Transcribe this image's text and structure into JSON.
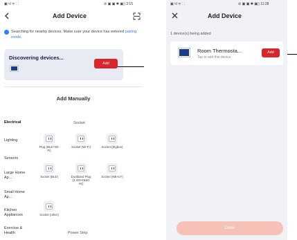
{
  "left": {
    "status_left": "▣ ᵗıl ᯤ ⸬",
    "status_right": "⊘ ▣ ▣ ✱ ▣▯ 3:15",
    "title": "Add Device",
    "info_text": "Searching for nearby devices. Make sure your device has entered",
    "info_link": "pairing mode.",
    "discover_title": "Discovering devices...",
    "discover_add": "Add",
    "manual_title": "Add Manually",
    "categories": [
      {
        "label": "Electrical",
        "active": true
      },
      {
        "label": "Lighting",
        "active": false
      },
      {
        "label": "Sensors",
        "active": false
      },
      {
        "label": "Large Home Ap...",
        "active": false
      },
      {
        "label": "Small Home Ap...",
        "active": false
      },
      {
        "label": "Kitchen Appliances",
        "active": false
      },
      {
        "label": "Exercise & Health",
        "active": false
      }
    ],
    "subhead_socket": "Socket",
    "subhead_power_strip": "Power Strip",
    "products": [
      {
        "label": "Plug (BLE+Wi-Fi)"
      },
      {
        "label": "Socket (Wi-Fi)"
      },
      {
        "label": "Socket (Zigbee)"
      },
      {
        "label": "Socket (BLE)"
      },
      {
        "label": "Dualband Plug (2.4GHz&5G Hz)"
      },
      {
        "label": "Socket (NB-IoT)"
      },
      {
        "label": "Socket (other)"
      }
    ]
  },
  "right": {
    "status_left": "▣ ᵗıl ᯤ ⸬",
    "status_right": "⊘ ▣ ▣ ✱ ▣▯ 11:28",
    "title": "Add Device",
    "adding_label": "1 device(s) being added",
    "device_name": "Room Thermosta...",
    "device_sub": "Tap to add this device",
    "device_add": "Add",
    "done_label": "Done"
  },
  "colors": {
    "accent_red": "#d8262b",
    "link_blue": "#2d7ff3",
    "device_blue": "#1b3a8a",
    "done_disabled": "#f6c1b7"
  },
  "icons": [
    "back-arrow-icon",
    "scan-icon",
    "close-icon",
    "info-icon",
    "socket-icon"
  ]
}
